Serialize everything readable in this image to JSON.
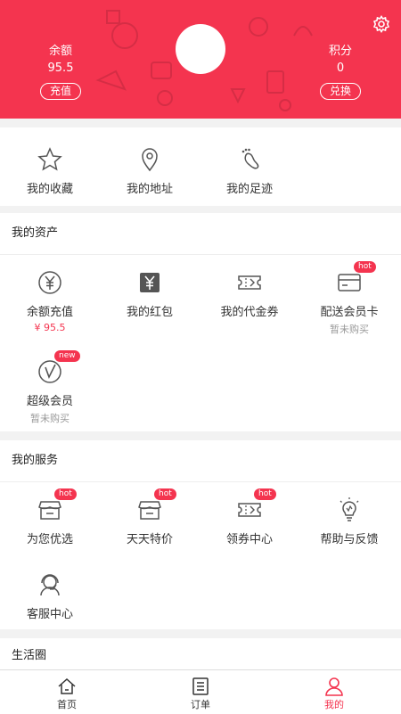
{
  "header": {
    "balance_label": "余额",
    "balance_value": "95.5",
    "recharge_button": "充值",
    "points_label": "积分",
    "points_value": "0",
    "redeem_button": "兑换",
    "settings_icon": "gear-icon"
  },
  "quick_links": [
    {
      "label": "我的收藏",
      "icon": "star-icon"
    },
    {
      "label": "我的地址",
      "icon": "location-pin-icon"
    },
    {
      "label": "我的足迹",
      "icon": "footprint-icon"
    }
  ],
  "assets": {
    "title": "我的资产",
    "items": [
      {
        "label": "余额充值",
        "sub": "¥ 95.5",
        "icon": "yen-coin-icon"
      },
      {
        "label": "我的红包",
        "icon": "red-packet-icon"
      },
      {
        "label": "我的代金券",
        "icon": "voucher-icon"
      },
      {
        "label": "配送会员卡",
        "sub": "暂未购买",
        "badge": "hot",
        "icon": "card-icon"
      },
      {
        "label": "超级会员",
        "sub": "暂未购买",
        "badge": "new",
        "icon": "super-vip-icon"
      }
    ]
  },
  "services": {
    "title": "我的服务",
    "items": [
      {
        "label": "为您优选",
        "badge": "hot",
        "icon": "shop-icon"
      },
      {
        "label": "天天特价",
        "badge": "hot",
        "icon": "shop-icon"
      },
      {
        "label": "领券中心",
        "badge": "hot",
        "icon": "ticket-icon"
      },
      {
        "label": "帮助与反馈",
        "icon": "lightbulb-icon"
      },
      {
        "label": "客服中心",
        "icon": "customer-service-icon"
      }
    ]
  },
  "life": {
    "title": "生活圈"
  },
  "tabbar": {
    "items": [
      {
        "label": "首页",
        "icon": "home-icon"
      },
      {
        "label": "订单",
        "icon": "order-list-icon"
      },
      {
        "label": "我的",
        "icon": "user-icon",
        "active": true
      }
    ]
  },
  "colors": {
    "accent": "#f4344f",
    "icon_gray": "#555555"
  }
}
